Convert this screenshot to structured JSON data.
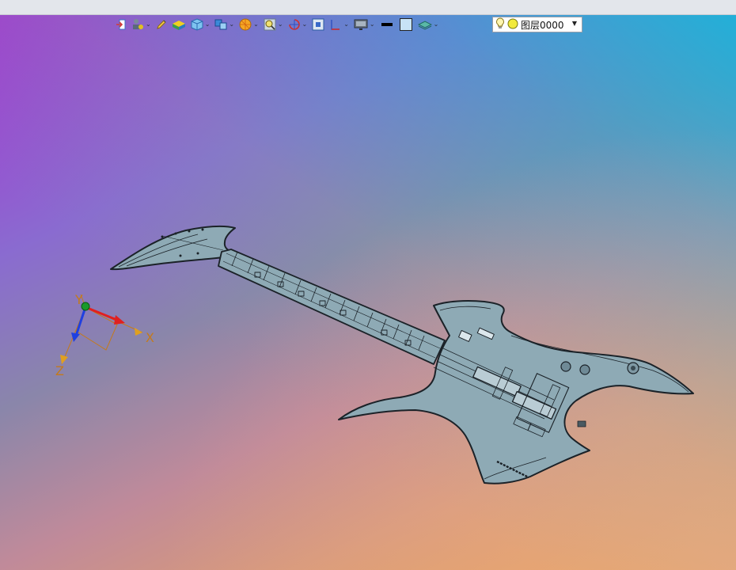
{
  "toolbar": {
    "items": [
      {
        "name": "import-part-icon",
        "dropdown": false
      },
      {
        "name": "assembly-tool-icon",
        "dropdown": true
      },
      {
        "name": "pen-tool-icon",
        "dropdown": false
      },
      {
        "name": "solid-shaded-icon",
        "dropdown": false
      },
      {
        "name": "cube-view-icon",
        "dropdown": true
      },
      {
        "name": "multi-view-icon",
        "dropdown": true
      },
      {
        "name": "render-style-icon",
        "dropdown": true
      },
      {
        "name": "zoom-icon",
        "dropdown": true
      },
      {
        "name": "rotate-icon",
        "dropdown": true
      },
      {
        "name": "fit-view-icon",
        "dropdown": false
      },
      {
        "name": "section-view-icon",
        "dropdown": true
      },
      {
        "name": "display-monitor-icon",
        "dropdown": true
      },
      {
        "name": "line-color-icon",
        "dropdown": false
      },
      {
        "name": "fill-color-icon",
        "dropdown": false
      },
      {
        "name": "layer-manager-icon",
        "dropdown": true
      }
    ],
    "layer": {
      "label": "图层0000",
      "icons": [
        "lightbulb-icon",
        "layer-status-icon"
      ]
    }
  },
  "triad": {
    "x_label": "X",
    "y_label": "Y",
    "z_label": "Z"
  },
  "colors": {
    "model_fill": "#8eaab5",
    "model_stroke": "#1b2228",
    "axis_x": "#e02020",
    "axis_y": "#1a9a2a",
    "axis_z": "#2040e0",
    "axis_text": "#c47a1c"
  }
}
